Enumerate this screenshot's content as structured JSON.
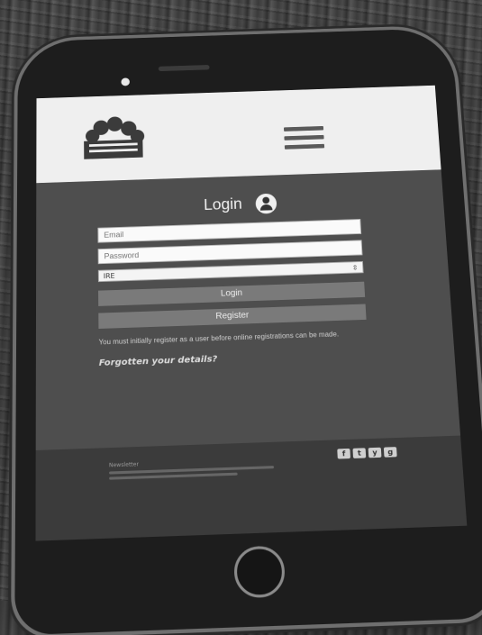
{
  "menu": {
    "icon": "hamburger-menu-icon"
  },
  "logo": {
    "icon": "flower-basket-logo"
  },
  "login": {
    "title": "Login",
    "user_icon": "user-avatar-icon",
    "email_placeholder": "Email",
    "password_placeholder": "Password",
    "country_selected": "IRE",
    "login_button": "Login",
    "register_button": "Register",
    "note": "You must initially register as a user before online registrations can be made.",
    "forgot_link": "Forgotten your details?"
  },
  "footer": {
    "title": "Newsletter",
    "socials": [
      "f",
      "t",
      "y",
      "g"
    ]
  }
}
